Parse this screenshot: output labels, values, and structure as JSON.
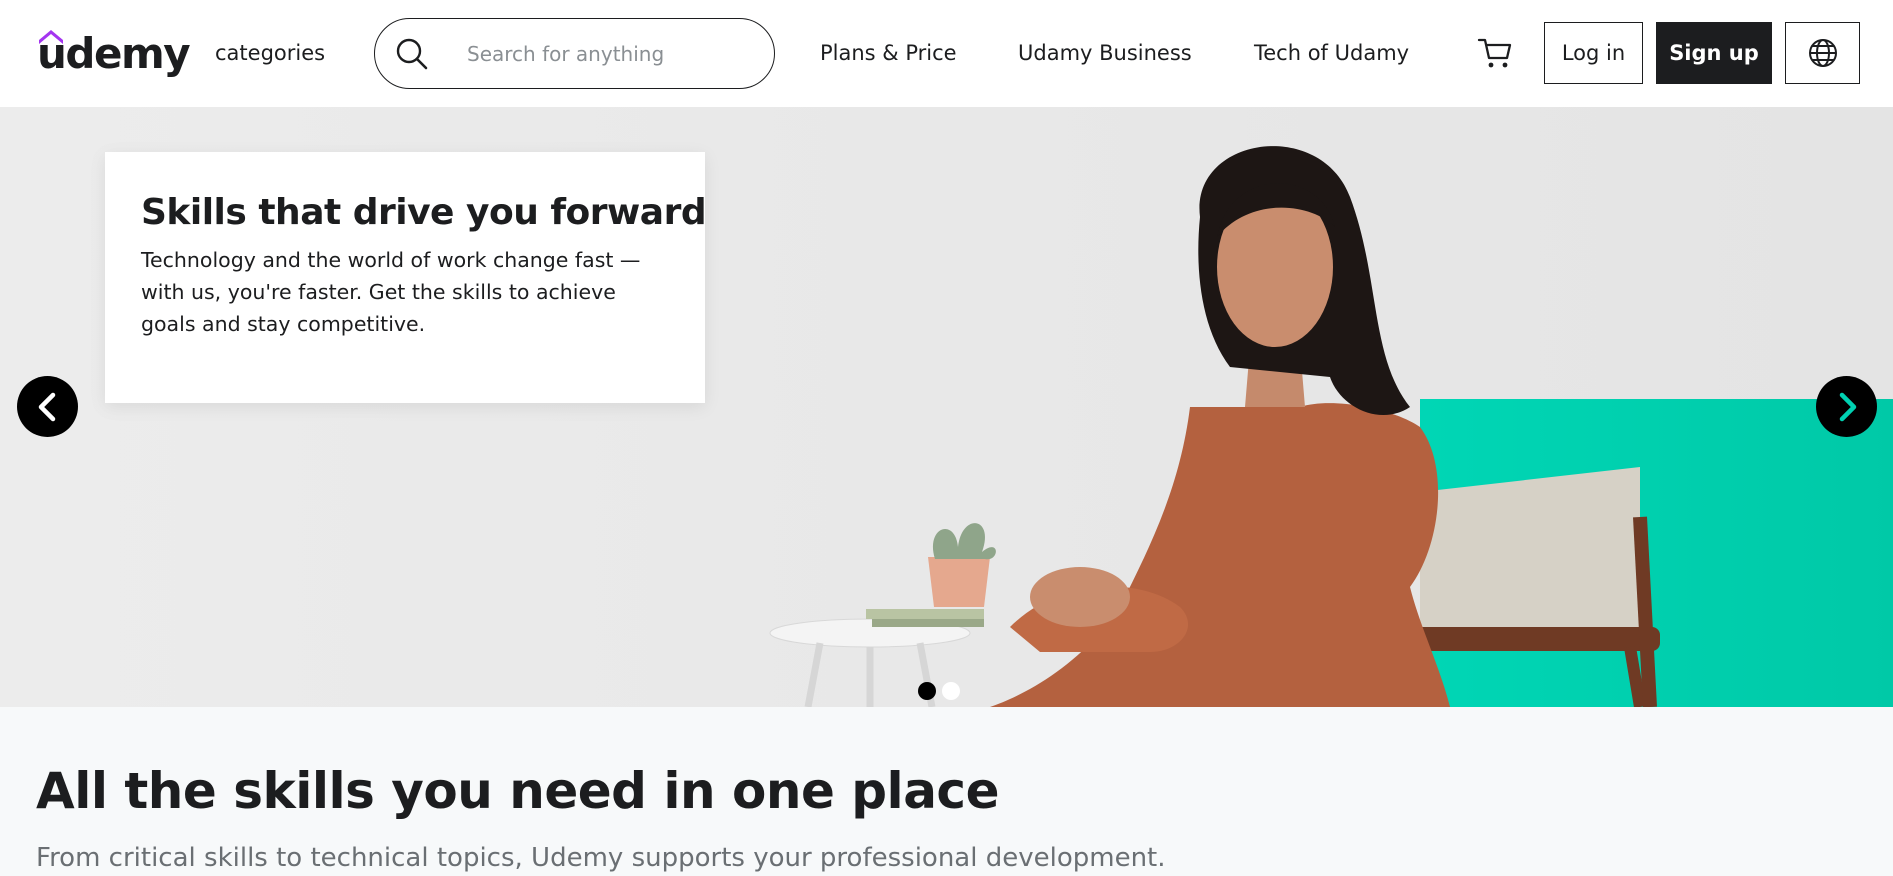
{
  "header": {
    "logo_text": "udemy",
    "nav": {
      "categories": "categories",
      "plans": "Plans & Price",
      "business": "Udamy Business",
      "tech": "Tech of Udamy"
    },
    "search": {
      "placeholder": "Search for anything"
    },
    "buttons": {
      "login": "Log in",
      "signup": "Sign up"
    },
    "icons": [
      "search-icon",
      "cart-icon",
      "globe-icon"
    ]
  },
  "hero": {
    "title": "Skills that drive you forward",
    "text": "Technology and the world of work change fast — with us, you're faster. Get the skills to achieve goals and stay competitive.",
    "carousel": {
      "slide_count": 2,
      "active_slide": 1
    },
    "icons": [
      "chevron-left-icon",
      "chevron-right-icon"
    ],
    "accent_color": "#00d1b2"
  },
  "section": {
    "title": "All the skills you need in one place",
    "subtitle": "From critical skills to technical topics, Udemy supports your professional development."
  },
  "colors": {
    "brand_purple": "#a435f0",
    "text_dark": "#1c1d1f",
    "text_muted": "#6a6f73",
    "hero_bg": "#ebebeb",
    "teal": "#00d1b2"
  }
}
